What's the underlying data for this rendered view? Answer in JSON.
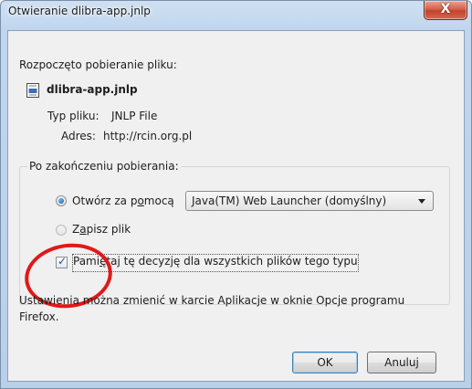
{
  "window": {
    "title": "Otwieranie dlibra-app.jnlp",
    "close_label": "X"
  },
  "download": {
    "intro": "Rozpoczęto pobieranie pliku:",
    "file_name": "dlibra-app.jnlp",
    "file_icon": "document-icon",
    "type_label": "Typ pliku:",
    "type_value": "JNLP File",
    "address_label": "Adres:",
    "address_value": "http://rcin.org.pl"
  },
  "after_download": {
    "legend": "Po zakończeniu pobierania:",
    "open_with_prefix": "Otwórz za p",
    "open_with_underlined": "o",
    "open_with_suffix": "mocą",
    "open_with_selected": true,
    "app_select_value": "Java(TM) Web Launcher (domyślny)",
    "save_prefix": "Z",
    "save_underlined": "a",
    "save_suffix": "pisz plik",
    "save_selected": false,
    "remember_prefix": "Pami",
    "remember_underlined": "ę",
    "remember_suffix": "taj tę decyzję dla wszystkich plików tego typu",
    "remember_checked": true
  },
  "note_line1": "Ustawienia można zmienić w karcie Aplikacje w oknie Opcje programu",
  "note_line2": "Firefox.",
  "buttons": {
    "ok": "OK",
    "cancel": "Anuluj"
  },
  "annotation_color": "#e11818"
}
